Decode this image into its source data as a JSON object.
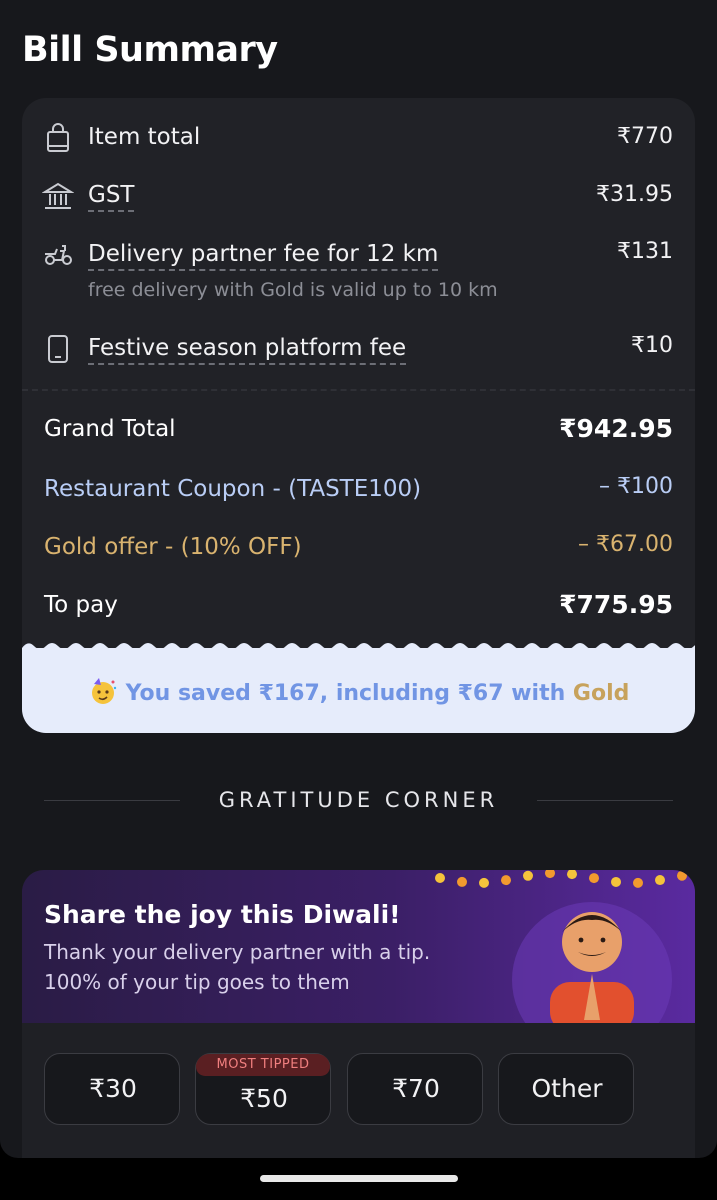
{
  "title": "Bill Summary",
  "bill": {
    "item_total": {
      "label": "Item total",
      "amount": "₹770",
      "icon": "shopping-bag-icon"
    },
    "gst": {
      "label": "GST",
      "amount": "₹31.95",
      "icon": "bank-icon"
    },
    "delivery": {
      "label": "Delivery partner fee for 12 km",
      "sub": "free delivery with Gold is valid up to 10 km",
      "amount": "₹131",
      "icon": "scooter-icon"
    },
    "platform": {
      "label": "Festive season platform fee",
      "amount": "₹10",
      "icon": "phone-icon"
    },
    "grand_total": {
      "label": "Grand Total",
      "amount": "₹942.95"
    },
    "coupon": {
      "label": "Restaurant Coupon - (TASTE100)",
      "amount": "– ₹100",
      "color": "#b9cdf5"
    },
    "gold_offer": {
      "label": "Gold offer - (10% OFF)",
      "amount": "– ₹67.00",
      "color": "#d9b36f"
    },
    "to_pay": {
      "label": "To pay",
      "amount": "₹775.95"
    },
    "saved": {
      "prefix": "You saved ₹167, including ₹67 with ",
      "gold_word": "Gold",
      "icon": "party-face-icon"
    }
  },
  "gratitude": {
    "heading": "GRATITUDE CORNER"
  },
  "tip": {
    "title": "Share the joy this Diwali!",
    "line1": "Thank your delivery partner with a tip.",
    "line2": "100% of your tip goes to them",
    "options": [
      {
        "value": "₹30"
      },
      {
        "value": "₹50",
        "badge": "MOST TIPPED"
      },
      {
        "value": "₹70"
      },
      {
        "value": "Other"
      }
    ]
  },
  "colors": {
    "background": "#17181c",
    "card": "#212227",
    "accent_blue": "#7195e4",
    "accent_gold": "#c7a25c"
  }
}
